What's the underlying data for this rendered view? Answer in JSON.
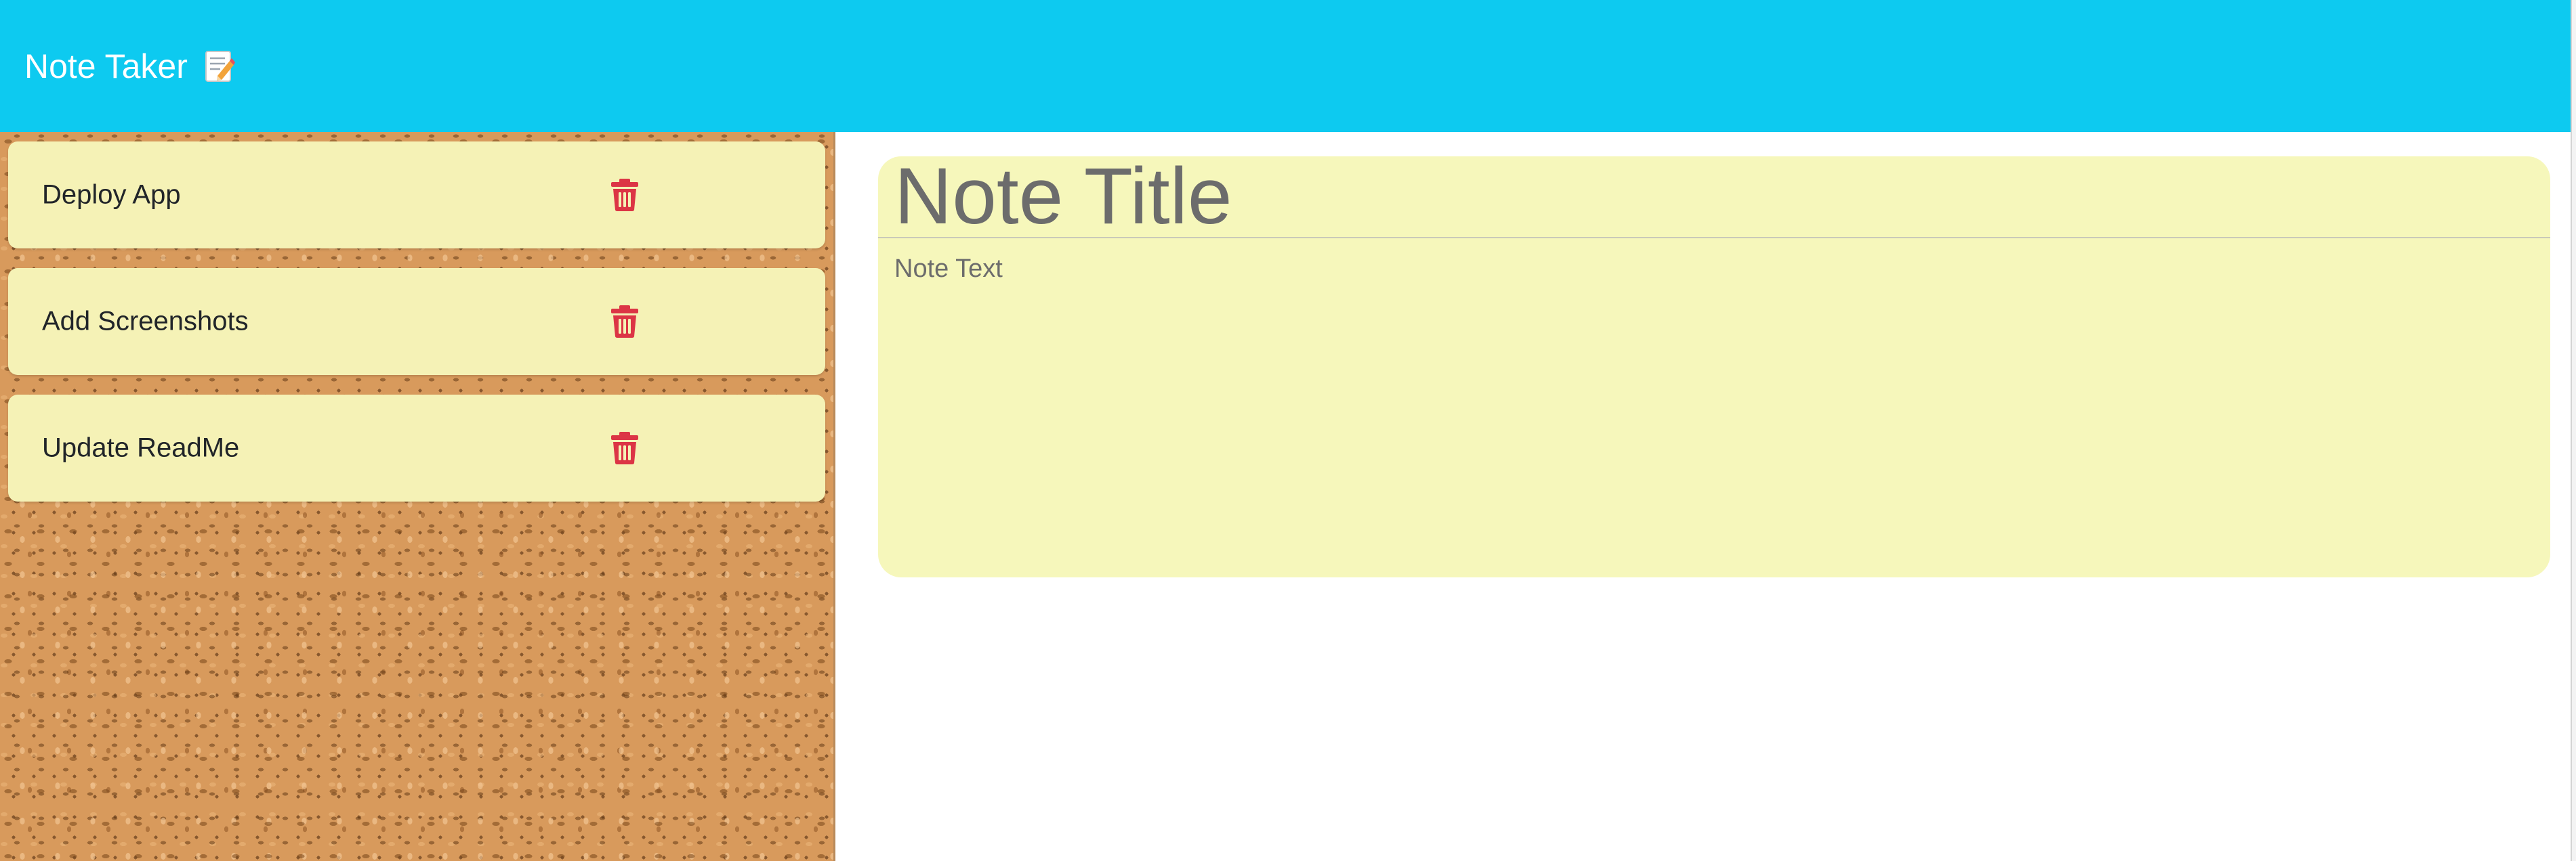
{
  "header": {
    "brand_label": "Note Taker",
    "brand_icon": "memo-icon"
  },
  "notes": [
    {
      "title": "Deploy App"
    },
    {
      "title": "Add Screenshots"
    },
    {
      "title": "Update ReadMe"
    }
  ],
  "editor": {
    "title_placeholder": "Note Title",
    "title_value": "",
    "text_placeholder": "Note Text",
    "text_value": ""
  },
  "icons": {
    "delete": "trash-icon"
  },
  "colors": {
    "navbar": "#0dcaf0",
    "note_card": "#f5f2b6",
    "editor_bg": "#f6f7bb",
    "delete_icon": "#dc3545",
    "cork": "#d89a5c"
  }
}
